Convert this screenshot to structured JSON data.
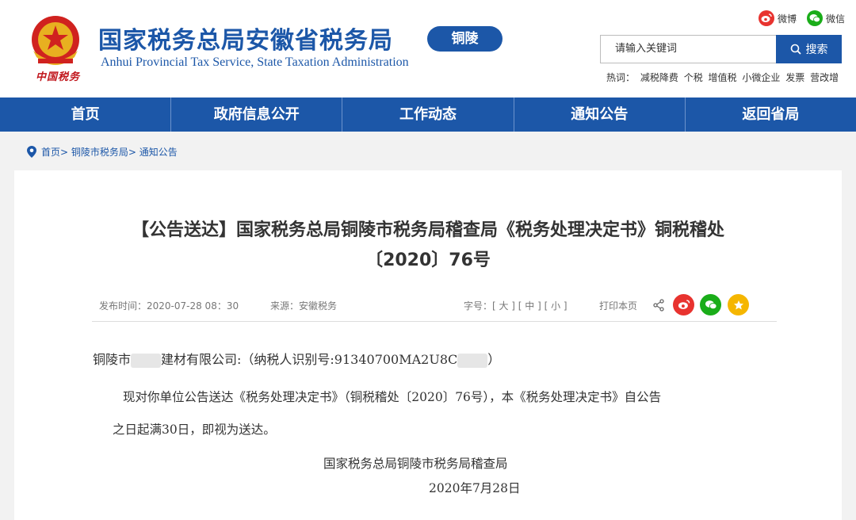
{
  "header": {
    "emblem_text": "中国税务",
    "title_cn": "国家税务总局安徽省税务局",
    "city": "铜陵",
    "title_en": "Anhui Provincial Tax Service, State Taxation Administration",
    "weibo": "微博",
    "wechat": "微信",
    "search_placeholder": "请输入关键词",
    "search_button": "搜索",
    "hot_label": "热词：",
    "hot_words": [
      "减税降费",
      "个税",
      "增值税",
      "小微企业",
      "发票",
      "营改增"
    ]
  },
  "nav": [
    "首页",
    "政府信息公开",
    "工作动态",
    "通知公告",
    "返回省局"
  ],
  "breadcrumb": [
    "首页>",
    "铜陵市税务局>",
    "通知公告"
  ],
  "article": {
    "title_line1": "【公告送达】国家税务总局铜陵市税务局稽查局《税务处理决定书》铜税稽处",
    "title_line2": "〔2020〕76号",
    "published": "发布时间：2020-07-28  08：30",
    "source": "来源：安徽税务",
    "font_size": "字号：[ 大 ] [ 中 ] [ 小 ]",
    "print": "打印本页",
    "recipient_pre": "铜陵市",
    "recipient_mid": "建材有限公司:（纳税人识别号:91340700MA2U8C",
    "recipient_post": "）",
    "para1": "现对你单位公告送达《税务处理决定书》（铜税稽处〔2020〕76号），本《税务处理决定书》自公告",
    "para2": "之日起满30日，即视为送达。",
    "signature": "国家税务总局铜陵市税务局稽查局",
    "date": "2020年7月28日"
  },
  "colors": {
    "brand_blue": "#1c57a8",
    "weibo_red": "#e8332f",
    "wechat_green": "#1aad19",
    "star_yellow": "#f5b600"
  }
}
